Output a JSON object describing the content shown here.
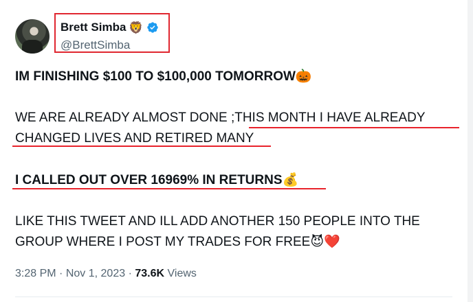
{
  "author": {
    "display_name": "Brett Simba",
    "name_emoji": "🦁",
    "handle": "@BrettSimba",
    "verified_icon": "verified-badge-icon",
    "verified_color": "#1d9bf0"
  },
  "tweet": {
    "line1": "IM FINISHING $100 TO $100,000 TOMORROW",
    "line1_emoji": "🎃",
    "line2": "WE ARE ALREADY ALMOST DONE ;THIS MONTH I HAVE ALREADY",
    "line3": "CHANGED LIVES AND RETIRED MANY",
    "line4": "I CALLED OUT OVER 16969% IN RETURNS",
    "line4_emoji": "💰",
    "line5": "LIKE THIS TWEET AND ILL ADD ANOTHER 150 PEOPLE INTO THE",
    "line6": "GROUP WHERE I POST MY TRADES FOR FREE",
    "line6_emoji": "😈❤️"
  },
  "meta": {
    "time": "3:28 PM",
    "separator1": "·",
    "date": "Nov 1, 2023",
    "separator2": "·",
    "views_count": "73.6K",
    "views_label": "Views"
  },
  "colors": {
    "highlight": "#e8222b",
    "muted_text": "#536471"
  }
}
